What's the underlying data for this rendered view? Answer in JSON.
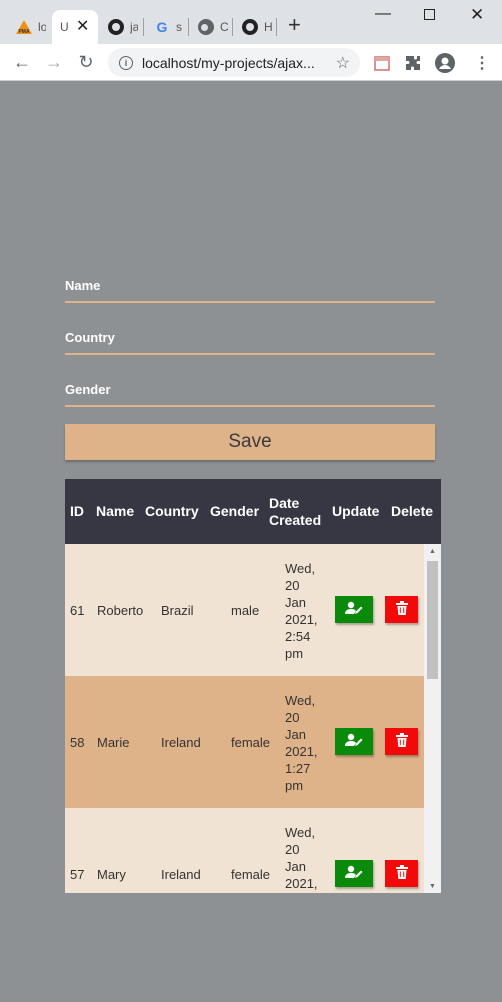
{
  "browser": {
    "tabs": [
      {
        "icon": "pma-icon",
        "glyph": "PMA",
        "title": "lo"
      },
      {
        "icon": "page-icon",
        "glyph": "",
        "title": "U"
      },
      {
        "icon": "github-icon",
        "glyph": "",
        "title": "ja"
      },
      {
        "icon": "google-icon",
        "glyph": "G",
        "title": "s"
      },
      {
        "icon": "globe-icon",
        "glyph": "",
        "title": "C"
      },
      {
        "icon": "github-icon",
        "glyph": "",
        "title": "H"
      }
    ],
    "url": "localhost/my-projects/ajax..."
  },
  "form": {
    "name_label": "Name",
    "country_label": "Country",
    "gender_label": "Gender",
    "save_label": "Save"
  },
  "table": {
    "headers": {
      "id": "ID",
      "name": "Name",
      "country": "Country",
      "gender": "Gender",
      "date_line1": "Date",
      "date_line2": "Created",
      "update": "Update",
      "delete": "Delete"
    },
    "rows": [
      {
        "id": "61",
        "name": "Roberto",
        "country": "Brazil",
        "gender": "male",
        "date": [
          "Wed,",
          "20",
          "Jan",
          "2021,",
          "2:54",
          "pm"
        ]
      },
      {
        "id": "58",
        "name": "Marie",
        "country": "Ireland",
        "gender": "female",
        "date": [
          "Wed,",
          "20",
          "Jan",
          "2021,",
          "1:27",
          "pm"
        ]
      },
      {
        "id": "57",
        "name": "Mary",
        "country": "Ireland",
        "gender": "female",
        "date": [
          "Wed,",
          "20",
          "Jan",
          "2021,"
        ]
      }
    ]
  },
  "colors": {
    "page_bg": "#8e9193",
    "accent": "#dfb38a",
    "header_bg": "#363743",
    "row_light": "#f0e3d3",
    "update_button": "#0a8a0a",
    "delete_button": "#f20a0a"
  }
}
